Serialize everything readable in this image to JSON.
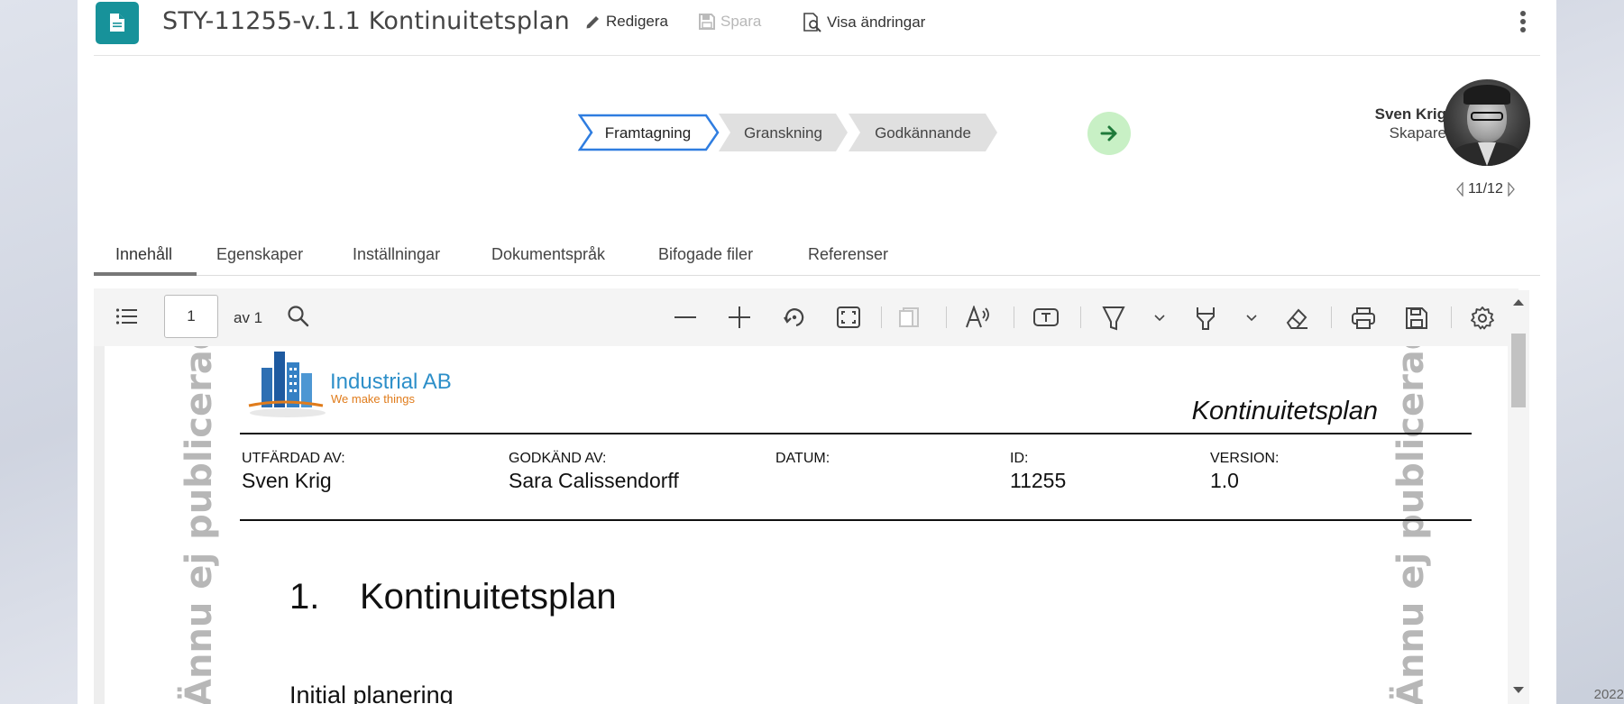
{
  "header": {
    "title": "STY-11255-v.1.1 Kontinuitetsplan",
    "actions": {
      "edit": "Redigera",
      "save": "Spara",
      "show_changes": "Visa ändringar"
    }
  },
  "workflow": {
    "steps": [
      "Framtagning",
      "Granskning",
      "Godkännande"
    ],
    "active_index": 0
  },
  "user": {
    "name": "Sven Krig",
    "role": "Skapare",
    "pager": "11/12"
  },
  "tabs": [
    "Innehåll",
    "Egenskaper",
    "Inställningar",
    "Dokumentspråk",
    "Bifogade filer",
    "Referenser"
  ],
  "viewer": {
    "page_value": "1",
    "page_of": "av 1"
  },
  "document": {
    "company": "Industrial AB",
    "slogan": "We make things",
    "header_title": "Kontinuitetsplan",
    "watermark": "Ännu ej publicerad version",
    "meta": [
      {
        "label": "UTFÄRDAD AV:",
        "value": "Sven Krig"
      },
      {
        "label": "GODKÄND AV:",
        "value": "Sara Calissendorff"
      },
      {
        "label": "DATUM:",
        "value": ""
      },
      {
        "label": "ID:",
        "value": "11255"
      },
      {
        "label": "VERSION:",
        "value": "1.0"
      }
    ],
    "section_number": "1.",
    "section_title": "Kontinuitetsplan",
    "subheading": "Initial planering"
  },
  "footer_year": "2022",
  "colors": {
    "accent_teal": "#17929a",
    "active_step_border": "#2f7de0",
    "next_button": "#c8f0c5",
    "logo_blue": "#2d8fc9",
    "logo_orange": "#e07c1c"
  }
}
